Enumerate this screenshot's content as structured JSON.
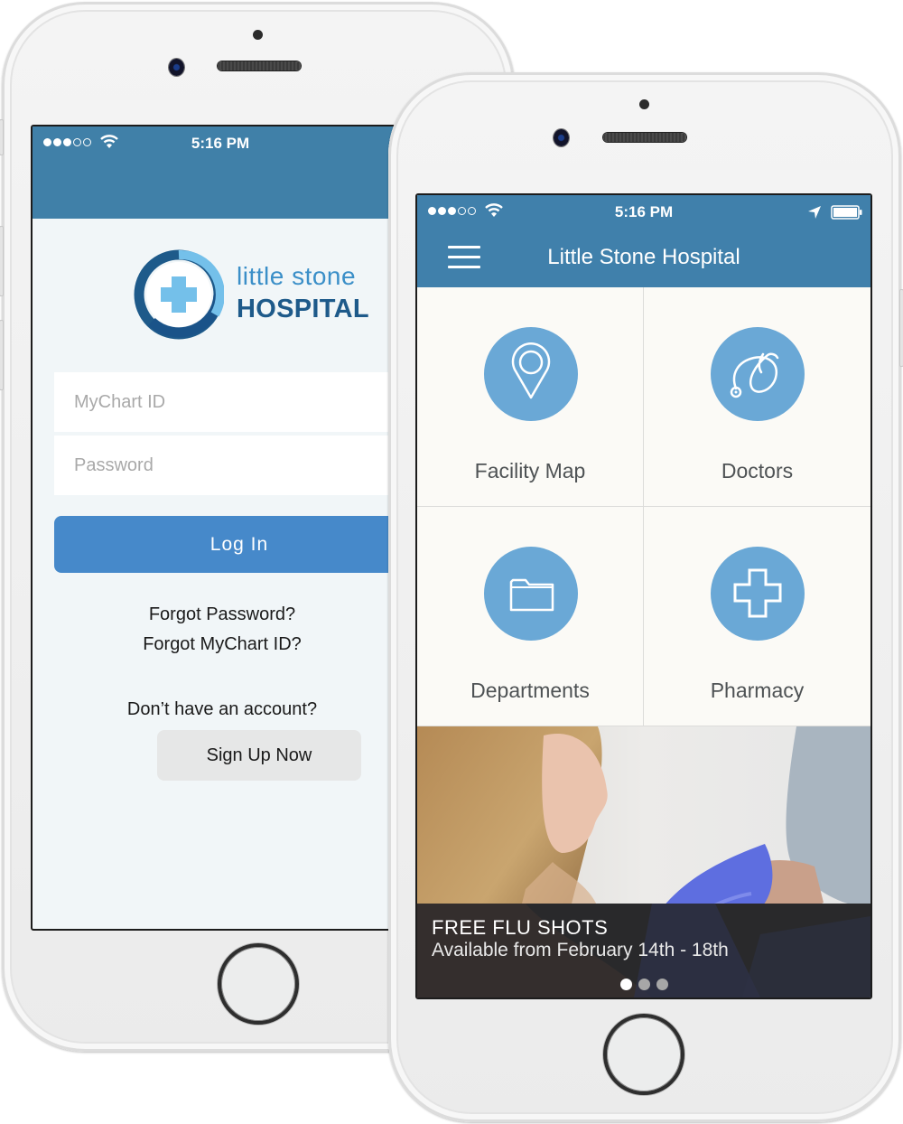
{
  "login_screen": {
    "status_bar": {
      "time": "5:16 PM",
      "signal_bars_filled": 3,
      "signal_bars_total": 5
    },
    "logo": {
      "line1": "little stone",
      "line2": "HOSPITAL"
    },
    "fields": {
      "mychart_id_placeholder": "MyChart ID",
      "password_placeholder": "Password"
    },
    "login_button": "Log In",
    "forgot_password": "Forgot Password?",
    "forgot_mychart_id": "Forgot MyChart ID?",
    "no_account_text": "Don’t have an account?",
    "signup_button": "Sign Up Now"
  },
  "home_screen": {
    "status_bar": {
      "time": "5:16 PM",
      "signal_bars_filled": 3,
      "signal_bars_total": 5
    },
    "title": "Little Stone Hospital",
    "tiles": [
      {
        "label": "Facility Map",
        "icon": "map-pin-icon"
      },
      {
        "label": "Doctors",
        "icon": "stethoscope-icon"
      },
      {
        "label": "Departments",
        "icon": "folder-icon"
      },
      {
        "label": "Pharmacy",
        "icon": "medical-cross-icon"
      }
    ],
    "banner": {
      "title": "FREE FLU SHOTS",
      "subtitle": "Available from February 14th - 18th",
      "slides_total": 3,
      "active_slide": 1
    }
  },
  "colors": {
    "header_blue": "#4080a8",
    "button_blue": "#4689ca",
    "icon_circle": "#6aa8d6",
    "logo_dark": "#1e5a8a",
    "logo_light": "#3b8fc8"
  }
}
